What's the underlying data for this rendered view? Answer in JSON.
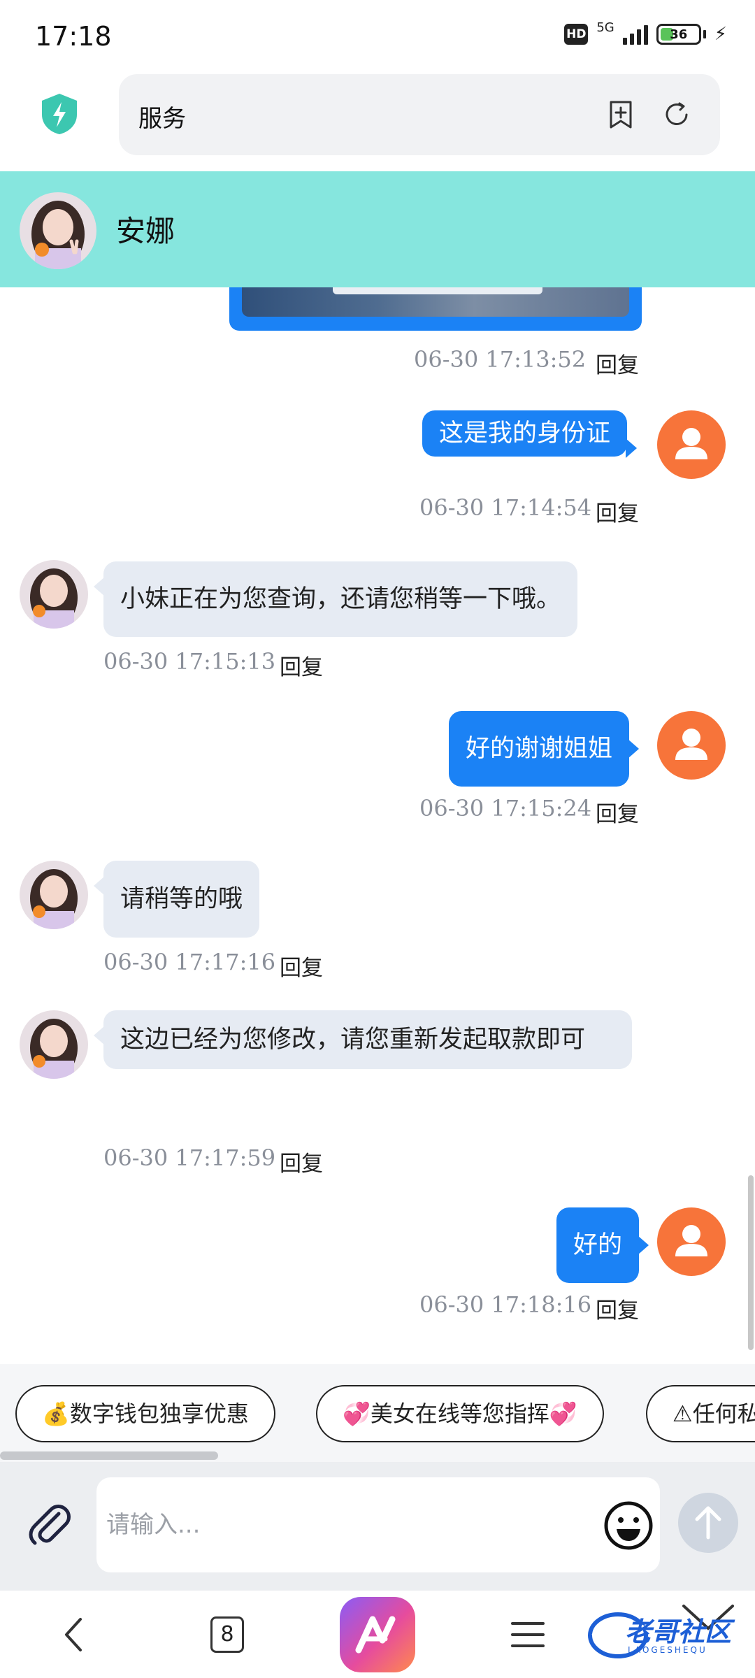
{
  "status_bar": {
    "time": "17:18",
    "hd": "HD",
    "network": "5G",
    "battery": "36",
    "battery_level_percent": 36
  },
  "browser": {
    "url_text": "服务",
    "icons": [
      "shield-lightning-icon",
      "bookmark-add-icon",
      "refresh-icon"
    ]
  },
  "chat_header": {
    "name": "安娜"
  },
  "messages": [
    {
      "from": "me",
      "type": "image",
      "time": "06-30 17:13:52",
      "reply": "回复"
    },
    {
      "from": "me",
      "text": "这是我的身份证",
      "time": "06-30 17:14:54",
      "reply": "回复"
    },
    {
      "from": "agent",
      "text": "小妹正在为您查询，还请您稍等一下哦。",
      "time": "06-30 17:15:13",
      "reply": "回复"
    },
    {
      "from": "me",
      "text": "好的谢谢姐姐",
      "time": "06-30 17:15:24",
      "reply": "回复"
    },
    {
      "from": "agent",
      "text": "请稍等的哦",
      "time": "06-30 17:17:16",
      "reply": "回复"
    },
    {
      "from": "agent",
      "text": "这边已经为您修改，请您重新发起取款即可",
      "time": "06-30 17:17:59",
      "reply": "回复"
    },
    {
      "from": "me",
      "text": "好的",
      "time": "06-30 17:18:16",
      "reply": "回复"
    }
  ],
  "quick_chips": [
    "💰数字钱包独享优惠",
    "💞美女在线等您指挥💞",
    "⚠任何私"
  ],
  "input": {
    "placeholder": "请输入..."
  },
  "bottom_nav": {
    "tab_count": "8",
    "watermark": "老哥社区",
    "watermark_sub": "LAOGESHEQU"
  },
  "colors": {
    "header_bg": "#86e6de",
    "my_bubble": "#1b82f5",
    "their_bubble": "#e6ebf3",
    "user_avatar": "#f7743a"
  }
}
